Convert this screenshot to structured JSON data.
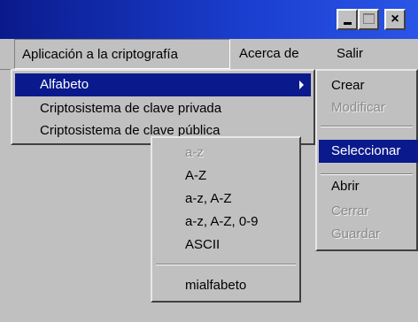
{
  "titlebar": {
    "controls": [
      {
        "name": "minimize",
        "glyph": "_"
      },
      {
        "name": "maximize",
        "glyph": "□"
      },
      {
        "name": "close",
        "glyph": "×"
      }
    ]
  },
  "menubar": {
    "items": [
      {
        "label": "Aplicación a la criptografía"
      },
      {
        "label": "Acerca de"
      },
      {
        "label": "Salir"
      }
    ]
  },
  "menu_main": {
    "items": [
      {
        "label": "Alfabeto",
        "state": "selected",
        "submenu": true
      },
      {
        "label": "Criptosistema de clave privada",
        "state": "enabled"
      },
      {
        "label": "Criptosistema de clave pública",
        "state": "enabled"
      }
    ]
  },
  "menu_alfabeto": {
    "items": [
      {
        "label": "Crear",
        "state": "enabled"
      },
      {
        "label": "Modificar",
        "state": "disabled"
      },
      {
        "label": "Seleccionar",
        "state": "selected"
      },
      {
        "label": "Abrir",
        "state": "enabled"
      },
      {
        "label": "Cerrar",
        "state": "disabled"
      },
      {
        "label": "Guardar",
        "state": "disabled"
      }
    ]
  },
  "menu_seleccionar": {
    "items": [
      {
        "label": "a-z",
        "state": "disabled"
      },
      {
        "label": "A-Z",
        "state": "enabled"
      },
      {
        "label": "a-z, A-Z",
        "state": "enabled"
      },
      {
        "label": "a-z, A-Z, 0-9",
        "state": "enabled"
      },
      {
        "label": "ASCII",
        "state": "enabled"
      },
      {
        "label": "mialfabeto",
        "state": "enabled"
      }
    ]
  },
  "colors": {
    "titlebar": "#0a1a8c",
    "highlight": "#0a1a8c",
    "menu_bg": "#c0c0c0",
    "disabled_text": "#8a8a8a"
  }
}
